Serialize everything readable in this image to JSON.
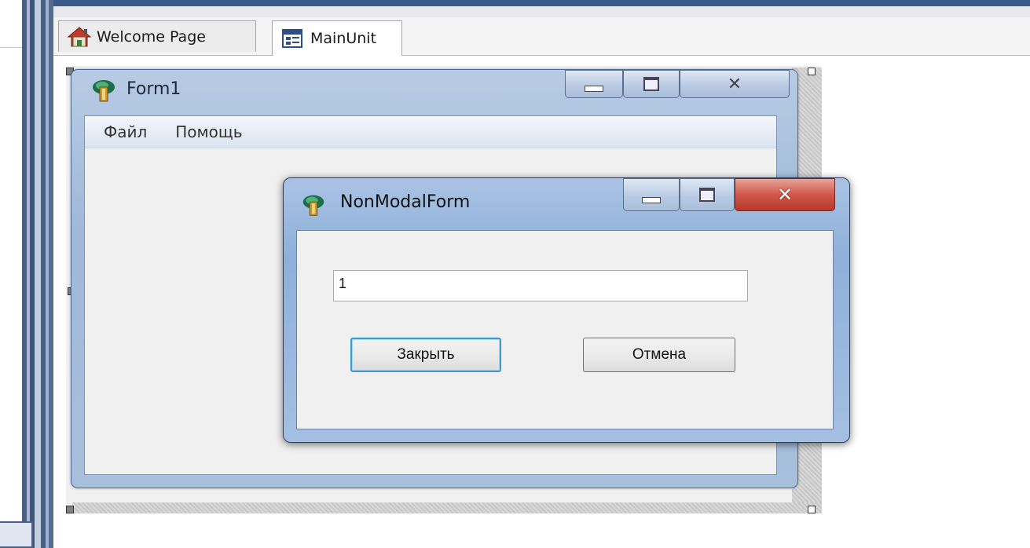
{
  "tabs": [
    {
      "label": "Welcome Page",
      "icon": "home-icon",
      "active": false
    },
    {
      "label": "MainUnit",
      "icon": "form-unit-icon",
      "active": true
    }
  ],
  "form1": {
    "title": "Form1",
    "icon": "delphi-app-icon",
    "menu": [
      "Файл",
      "Помощь"
    ]
  },
  "nonmodal": {
    "title": "NonModalForm",
    "icon": "delphi-app-icon",
    "edit_value": "1",
    "close_button": "Закрыть",
    "cancel_button": "Отмена"
  },
  "colors": {
    "caption_accent": "#3b5a8c",
    "close_red": "#c9473a",
    "focus_blue": "#3c9ad3"
  }
}
